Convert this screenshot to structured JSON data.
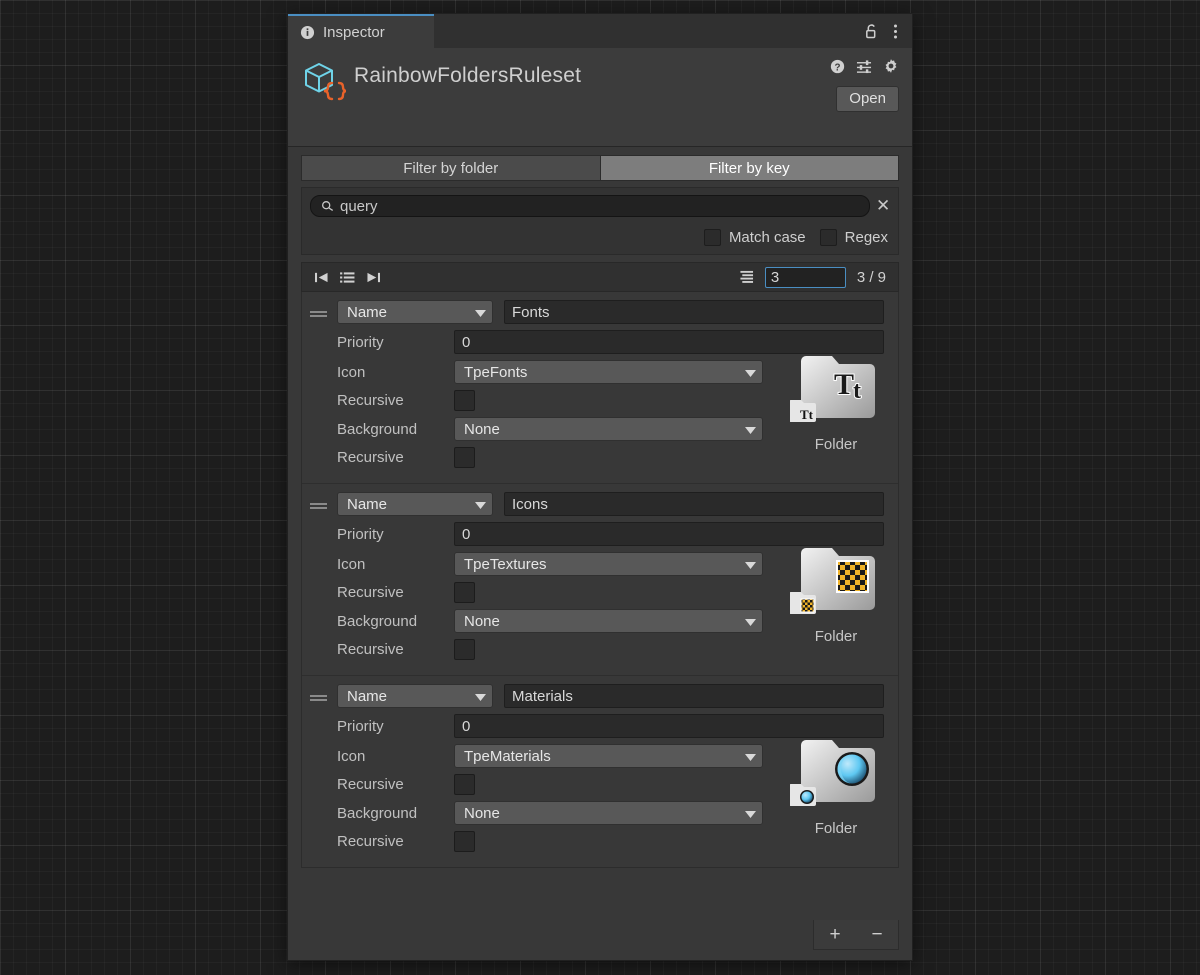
{
  "window": {
    "tab_label": "Inspector",
    "tab_icon": "info-icon",
    "lock_icon": "lock-open-icon",
    "menu_icon": "kebab-menu-icon"
  },
  "object_header": {
    "icon": "scriptable-object-icon",
    "title": "RainbowFoldersRuleset",
    "help_icon": "help-icon",
    "preset_icon": "preset-icon",
    "settings_icon": "gear-icon",
    "open_label": "Open"
  },
  "filter_tabs": [
    {
      "label": "Filter by folder",
      "active": false
    },
    {
      "label": "Filter by key",
      "active": true
    }
  ],
  "search": {
    "icon": "search-icon",
    "value": "query",
    "placeholder": "query",
    "clear_icon": "clear-x-icon",
    "options": [
      {
        "label": "Match case",
        "checked": false
      },
      {
        "label": "Regex",
        "checked": false
      }
    ]
  },
  "pager": {
    "first_icon": "skip-to-start-icon",
    "list_icon": "list-icon",
    "last_icon": "skip-to-end-icon",
    "size_icon": "page-size-icon",
    "page_value": "3",
    "count_label": "3 / 9"
  },
  "rules": [
    {
      "drag_handle": "drag-handle-icon",
      "match_mode": "Name",
      "name_value": "Fonts",
      "priority_label": "Priority",
      "priority_value": "0",
      "icon_label": "Icon",
      "icon_value": "TpeFonts",
      "icon_recursive_label": "Recursive",
      "icon_recursive_checked": false,
      "background_label": "Background",
      "background_value": "None",
      "background_recursive_label": "Recursive",
      "background_recursive_checked": false,
      "preview_caption": "Folder",
      "preview_icon": "folder-font-icon",
      "preview_badge_color": "#ffffff"
    },
    {
      "drag_handle": "drag-handle-icon",
      "match_mode": "Name",
      "name_value": "Icons",
      "priority_label": "Priority",
      "priority_value": "0",
      "icon_label": "Icon",
      "icon_value": "TpeTextures",
      "icon_recursive_label": "Recursive",
      "icon_recursive_checked": false,
      "background_label": "Background",
      "background_value": "None",
      "background_recursive_label": "Recursive",
      "background_recursive_checked": false,
      "preview_caption": "Folder",
      "preview_icon": "folder-texture-icon",
      "preview_badge_color": "#f0b429"
    },
    {
      "drag_handle": "drag-handle-icon",
      "match_mode": "Name",
      "name_value": "Materials",
      "priority_label": "Priority",
      "priority_value": "0",
      "icon_label": "Icon",
      "icon_value": "TpeMaterials",
      "icon_recursive_label": "Recursive",
      "icon_recursive_checked": false,
      "background_label": "Background",
      "background_value": "None",
      "background_recursive_label": "Recursive",
      "background_recursive_checked": false,
      "preview_caption": "Folder",
      "preview_icon": "folder-material-icon",
      "preview_badge_color": "#5ec8f2"
    }
  ],
  "footer": {
    "add_label": "+",
    "remove_label": "−"
  },
  "colors": {
    "accent_blue": "#4a8ec2",
    "panel_bg": "#383838",
    "header_bg": "#3c3c3c",
    "field_bg": "#2a2a2a",
    "popup_bg": "#585858",
    "tab_active": "#7d7d7d"
  }
}
